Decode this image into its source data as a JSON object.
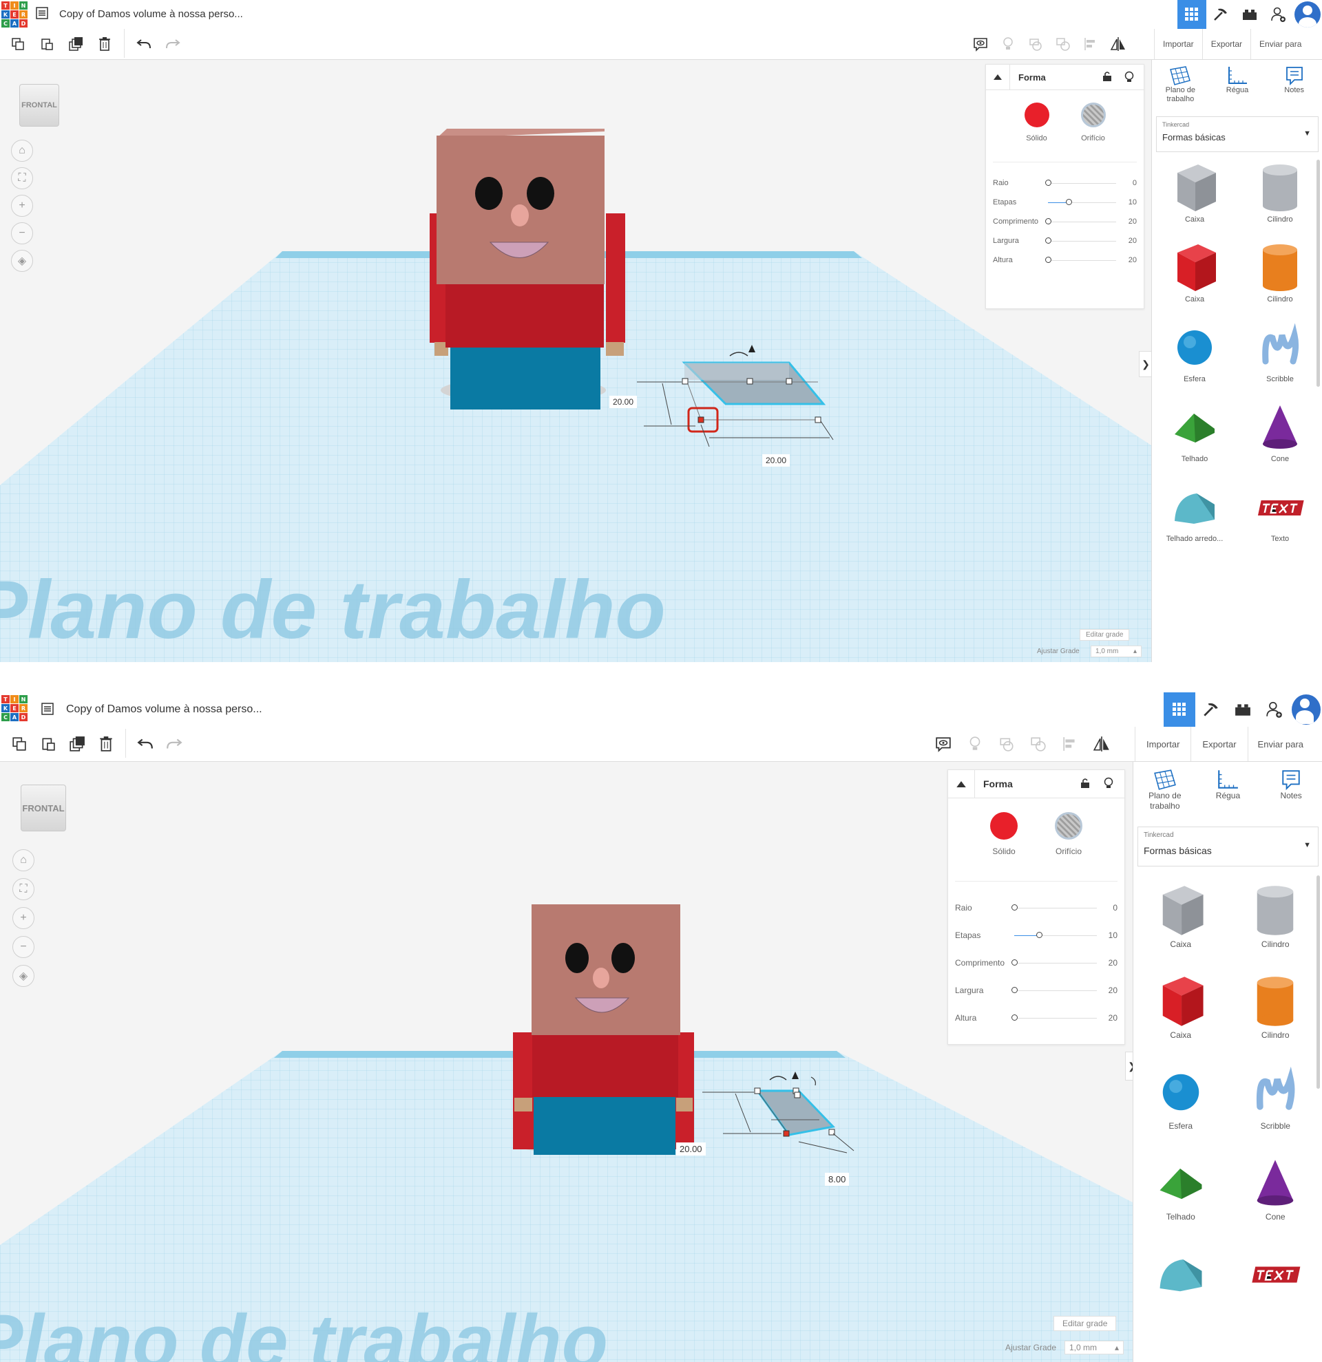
{
  "app": {
    "logo_letters": [
      "T",
      "I",
      "N",
      "K",
      "E",
      "R",
      "C",
      "A",
      "D"
    ]
  },
  "document": {
    "title": "Copy of Damos volume à nossa perso..."
  },
  "toolbar": {
    "import_label": "Importar",
    "export_label": "Exportar",
    "send_label": "Enviar para"
  },
  "viewcube": {
    "label": "FRONTAL"
  },
  "shape_panel": {
    "title": "Forma",
    "solid_label": "Sólido",
    "hole_label": "Orifício",
    "params": [
      {
        "label": "Raio",
        "value": "0",
        "fraction": 0.0
      },
      {
        "label": "Etapas",
        "value": "10",
        "fraction": 0.3
      },
      {
        "label": "Comprimento",
        "value": "20",
        "fraction": 0.0
      },
      {
        "label": "Largura",
        "value": "20",
        "fraction": 0.0
      },
      {
        "label": "Altura",
        "value": "20",
        "fraction": 0.0
      }
    ]
  },
  "library": {
    "tools": [
      {
        "label": "Plano de trabalho",
        "icon": "workplane-icon"
      },
      {
        "label": "Régua",
        "icon": "ruler-icon"
      },
      {
        "label": "Notes",
        "icon": "notes-icon"
      }
    ],
    "source_label": "Tinkercad",
    "category": "Formas básicas",
    "shapes": [
      {
        "label": "Caixa",
        "color": "#a9adb4"
      },
      {
        "label": "Cilindro",
        "color": "#b9bcc2"
      },
      {
        "label": "Caixa",
        "color": "#d81f26"
      },
      {
        "label": "Cilindro",
        "color": "#e87f1e"
      },
      {
        "label": "Esfera",
        "color": "#1a8fd1"
      },
      {
        "label": "Scribble",
        "color": "#8ab4e0"
      },
      {
        "label": "Telhado",
        "color": "#3aa33a"
      },
      {
        "label": "Cone",
        "color": "#7a2a9c"
      },
      {
        "label": "Telhado arredo...",
        "color": "#5cb8c9"
      },
      {
        "label": "Texto",
        "color": "#c0202a"
      }
    ]
  },
  "workplane": {
    "watermark": "Plano de trabalho",
    "edit_grid": "Editar grade",
    "snap_label": "Ajustar Grade",
    "snap_value": "1,0 mm"
  },
  "screens": [
    {
      "dim_height": "20.00",
      "dim_width": "20.00"
    },
    {
      "dim_height": "20.00",
      "dim_width": "8.00"
    }
  ]
}
